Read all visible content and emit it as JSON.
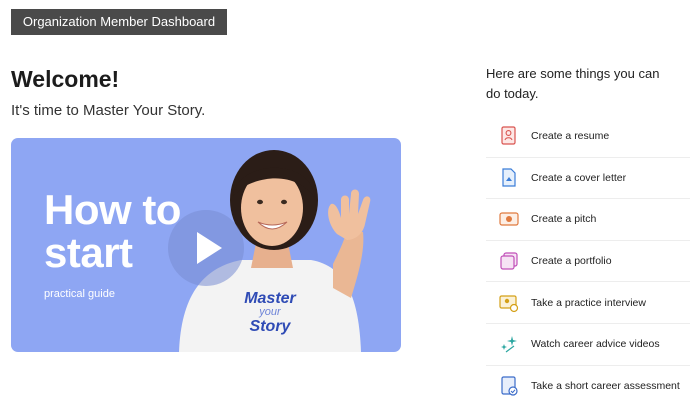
{
  "header": {
    "tag": "Organization Member Dashboard"
  },
  "welcome": {
    "title": "Welcome!",
    "subtitle": "It's time to Master Your Story."
  },
  "video": {
    "headline_line1": "How to",
    "headline_line2": "start",
    "caption": "practical guide",
    "shirt_line1": "Master",
    "shirt_line2": "your",
    "shirt_line3": "Story",
    "play_icon": "play-icon"
  },
  "panel": {
    "intro": "Here are some things you can do today.",
    "actions": [
      {
        "label": "Create a resume",
        "icon": "resume-icon",
        "color": "#d9534f"
      },
      {
        "label": "Create a cover letter",
        "icon": "cover-letter-icon",
        "color": "#3b7dd8"
      },
      {
        "label": "Create a pitch",
        "icon": "pitch-icon",
        "color": "#e07a3f"
      },
      {
        "label": "Create a portfolio",
        "icon": "portfolio-icon",
        "color": "#c14fb8"
      },
      {
        "label": "Take a practice interview",
        "icon": "interview-icon",
        "color": "#d4a017"
      },
      {
        "label": "Watch career advice videos",
        "icon": "sparkle-icon",
        "color": "#2aa6a0"
      },
      {
        "label": "Take a short career assessment",
        "icon": "assessment-icon",
        "color": "#3b6cc9"
      }
    ]
  }
}
